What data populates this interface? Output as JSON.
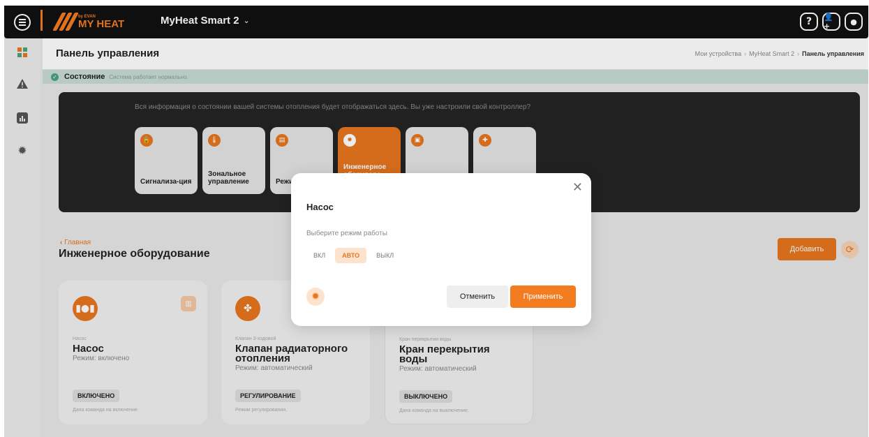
{
  "topbar": {
    "logo_text": "MY HEAT",
    "logo_sub": "by EVAN",
    "device": "MyHeat Smart 2",
    "icons": [
      "help-icon",
      "add-user-icon",
      "user-icon"
    ]
  },
  "sidebar": {
    "items": [
      "dashboard-icon",
      "warning-icon",
      "chart-icon",
      "gear-icon"
    ]
  },
  "header": {
    "title": "Панель управления",
    "breadcrumb": [
      "Мои устройства",
      "MyHeat Smart 2",
      "Панель управления"
    ]
  },
  "status": {
    "label": "Состояние",
    "text": "Система работает нормально."
  },
  "info": {
    "text": "Вся информация о состоянии вашей системы отопления будет отображаться здесь. Вы уже настроили свой контроллер?",
    "tiles": [
      {
        "label": "Сигнализа-ция",
        "icon": "lock-icon"
      },
      {
        "label": "Зональное управление",
        "icon": "thermometer-icon"
      },
      {
        "label": "Режимы и расп",
        "icon": "schedule-icon"
      },
      {
        "label": "Инженерное оборудова",
        "icon": "gear-icon"
      },
      {
        "label": "",
        "icon": "chip-icon"
      },
      {
        "label": "",
        "icon": "puzzle-icon"
      }
    ]
  },
  "section": {
    "back": "Главная",
    "title": "Инженерное оборудование",
    "add_label": "Добавить"
  },
  "equipment": [
    {
      "type": "Насос",
      "name": "Насос",
      "mode": "Режим: включено",
      "badge": "ВКЛЮЧЕНО",
      "command": "Дана команда на включение."
    },
    {
      "type": "Клапан 3-ходовой",
      "name": "Клапан радиаторного отопления",
      "mode": "Режим: автоматический",
      "badge": "РЕГУЛИРОВАНИЕ",
      "command": "Режим регулирования."
    },
    {
      "type": "Кран перекрытия воды",
      "name": "Кран перекрытия воды",
      "mode": "Режим: автоматический",
      "badge": "ВЫКЛЮЧЕНО",
      "command": "Дана команда на выключение."
    }
  ],
  "modal": {
    "title": "Насос",
    "subtitle": "Выберите режим работы",
    "modes": [
      "ВКЛ",
      "АВТО",
      "ВЫКЛ"
    ],
    "selected_mode": "АВТО",
    "cancel_label": "Отменить",
    "apply_label": "Применить"
  },
  "colors": {
    "accent": "#f47c20",
    "topbar": "#111111",
    "status_bg": "#c7dcd5",
    "status_ok": "#4ba37a"
  }
}
